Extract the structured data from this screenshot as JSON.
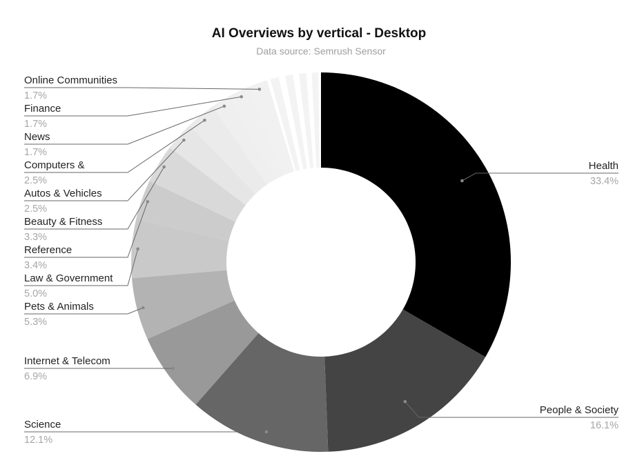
{
  "chart_data": {
    "type": "pie",
    "variant": "donut",
    "title": "AI Overviews by vertical - Desktop",
    "subtitle": "Data source: Semrush Sensor",
    "unit": "%",
    "start_angle": "12 o'clock",
    "direction": "clockwise",
    "slices": [
      {
        "label": "Health",
        "value": 33.4,
        "display": "33.4%",
        "color": "#000000",
        "side": "right"
      },
      {
        "label": "People & Society",
        "value": 16.1,
        "display": "16.1%",
        "color": "#444444",
        "side": "right"
      },
      {
        "label": "Science",
        "value": 12.1,
        "display": "12.1%",
        "color": "#666666",
        "side": "left"
      },
      {
        "label": "Internet & Telecom",
        "value": 6.9,
        "display": "6.9%",
        "color": "#999999",
        "side": "left"
      },
      {
        "label": "Pets & Animals",
        "value": 5.3,
        "display": "5.3%",
        "color": "#b3b3b3",
        "side": "left"
      },
      {
        "label": "Law & Government",
        "value": 5.0,
        "display": "5.0%",
        "color": "#c9c9c9",
        "side": "left"
      },
      {
        "label": "Reference",
        "value": 3.4,
        "display": "3.4%",
        "color": "#cccccc",
        "side": "left"
      },
      {
        "label": "Beauty & Fitness",
        "value": 3.3,
        "display": "3.3%",
        "color": "#d9d9d9",
        "side": "left"
      },
      {
        "label": "Autos & Vehicles",
        "value": 2.5,
        "display": "2.5%",
        "color": "#e6e6e6",
        "side": "left"
      },
      {
        "label": "Computers &",
        "value": 2.5,
        "display": "2.5%",
        "color": "#ebebeb",
        "side": "left"
      },
      {
        "label": "News",
        "value": 1.7,
        "display": "1.7%",
        "color": "#efefef",
        "side": "left"
      },
      {
        "label": "Finance",
        "value": 1.7,
        "display": "1.7%",
        "color": "#f0f0f0",
        "side": "left"
      },
      {
        "label": "Online Communities",
        "value": 1.7,
        "display": "1.7%",
        "color": "#f1f1f1",
        "side": "left"
      }
    ],
    "unlabeled_slices": [
      {
        "value": 1.3,
        "color": "#f3f3f3"
      },
      {
        "value": 1.2,
        "color": "#f3f3f3"
      },
      {
        "value": 1.1,
        "color": "#f3f3f3"
      },
      {
        "value": 1.0,
        "color": "#f3f3f3"
      }
    ],
    "legend": "none (leader-line labels)"
  }
}
